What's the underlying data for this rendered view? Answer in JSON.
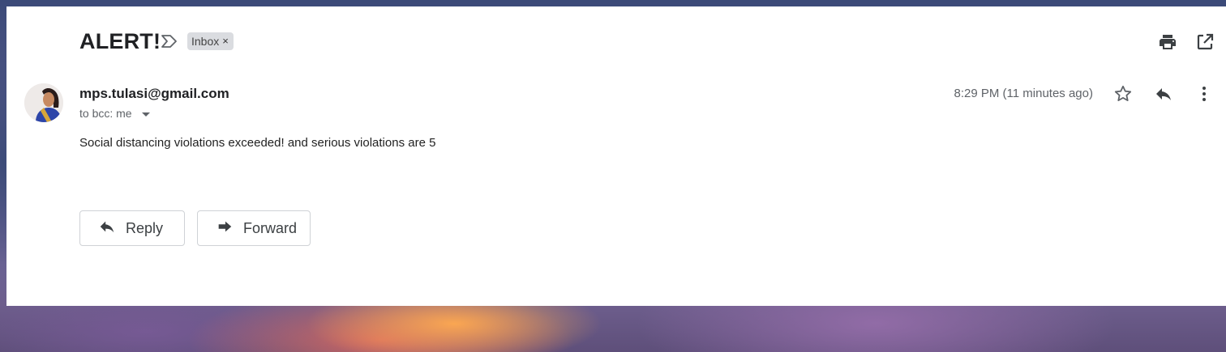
{
  "email": {
    "subject": "ALERT!",
    "label_chip": "Inbox",
    "label_chip_close": "×",
    "sender": "mps.tulasi@gmail.com",
    "recipients": "to bcc: me",
    "timestamp": "8:29 PM (11 minutes ago)",
    "body": "Social distancing violations exceeded! and serious violations are 5"
  },
  "actions": {
    "reply_label": "Reply",
    "forward_label": "Forward"
  },
  "icons": {
    "print": "print-icon",
    "new_window": "open-in-new-window-icon",
    "label_arrow": "label-importance-icon",
    "star": "star-icon",
    "reply": "reply-icon",
    "more": "more-vert-icon",
    "forward": "forward-icon"
  },
  "colors": {
    "text_primary": "#202124",
    "text_secondary": "#5f6368",
    "chip_background": "#dadce0",
    "panel": "#ffffff"
  }
}
